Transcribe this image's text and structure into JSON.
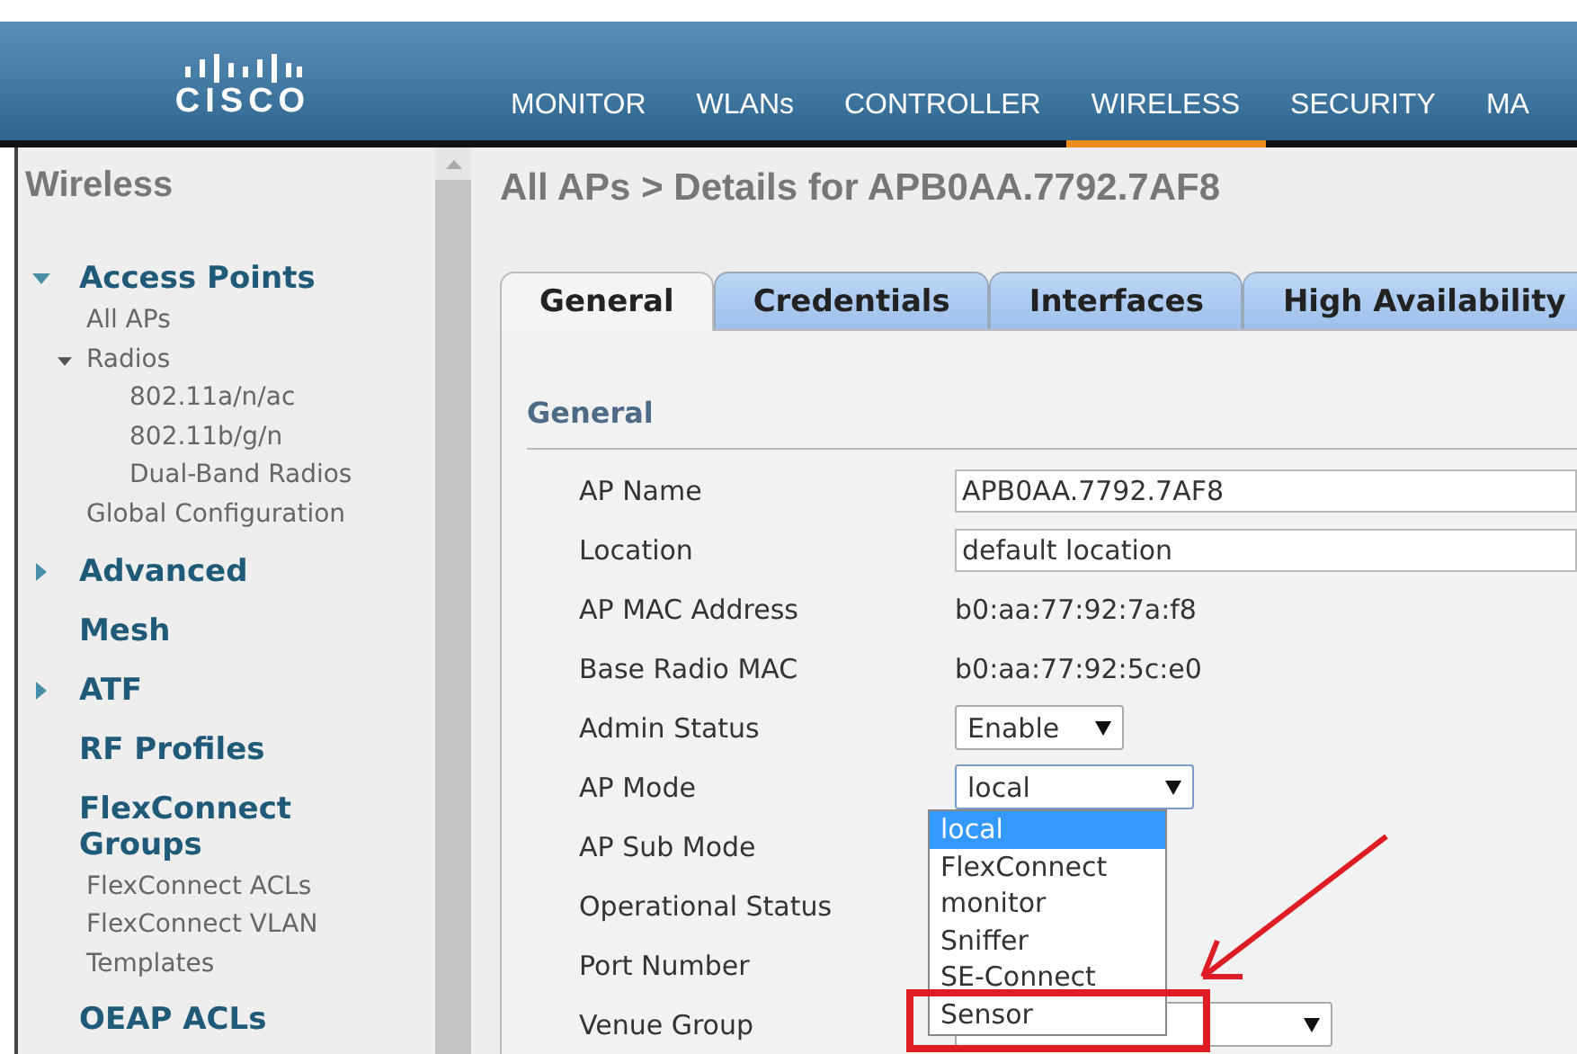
{
  "header": {
    "logo": "CISCO",
    "nav": [
      {
        "label": "MONITOR",
        "selected": false
      },
      {
        "label": "WLANs",
        "selected": false
      },
      {
        "label": "CONTROLLER",
        "selected": false
      },
      {
        "label": "WIRELESS",
        "selected": true
      },
      {
        "label": "SECURITY",
        "selected": false
      },
      {
        "label": "MA",
        "selected": false
      }
    ]
  },
  "sidebar": {
    "title": "Wireless",
    "sections": [
      {
        "label": "Access Points",
        "expanded": true,
        "children": [
          {
            "label": "All APs"
          },
          {
            "label": "Radios",
            "expanded": true,
            "children": [
              {
                "label": "802.11a/n/ac"
              },
              {
                "label": "802.11b/g/n"
              },
              {
                "label": "Dual-Band Radios"
              }
            ]
          },
          {
            "label": "Global Configuration"
          }
        ]
      },
      {
        "label": "Advanced",
        "expanded": false
      },
      {
        "label": "Mesh"
      },
      {
        "label": "ATF",
        "expanded": false
      },
      {
        "label": "RF Profiles"
      },
      {
        "label": "FlexConnect Groups",
        "children": [
          {
            "label": "FlexConnect ACLs"
          },
          {
            "label": "FlexConnect VLAN Templates"
          }
        ]
      },
      {
        "label": "OEAP ACLs"
      }
    ]
  },
  "main": {
    "breadcrumb": "All APs > Details for APB0AA.7792.7AF8",
    "tabs": [
      {
        "label": "General",
        "selected": true
      },
      {
        "label": "Credentials",
        "selected": false
      },
      {
        "label": "Interfaces",
        "selected": false
      },
      {
        "label": "High Availability",
        "selected": false
      }
    ],
    "section": "General",
    "fields": [
      {
        "label": "AP Name",
        "kind": "input",
        "value": "APB0AA.7792.7AF8"
      },
      {
        "label": "Location",
        "kind": "input",
        "value": "default location"
      },
      {
        "label": "AP MAC Address",
        "kind": "text",
        "value": "b0:aa:77:92:7a:f8"
      },
      {
        "label": "Base Radio MAC",
        "kind": "text",
        "value": "b0:aa:77:92:5c:e0"
      },
      {
        "label": "Admin Status",
        "kind": "select",
        "value": "Enable"
      },
      {
        "label": "AP Mode",
        "kind": "select",
        "value": "local",
        "open": true,
        "options": [
          {
            "label": "local",
            "selected": true,
            "highlighted": false
          },
          {
            "label": "FlexConnect",
            "selected": false,
            "highlighted": false
          },
          {
            "label": "monitor",
            "selected": false,
            "highlighted": false
          },
          {
            "label": "Sniffer",
            "selected": false,
            "highlighted": false
          },
          {
            "label": "SE-Connect",
            "selected": false,
            "highlighted": false
          },
          {
            "label": "Sensor",
            "selected": false,
            "highlighted": true
          }
        ]
      },
      {
        "label": "AP Sub Mode",
        "kind": "blank"
      },
      {
        "label": "Operational Status",
        "kind": "blank"
      },
      {
        "label": "Port Number",
        "kind": "blank"
      },
      {
        "label": "Venue Group",
        "kind": "select"
      }
    ]
  }
}
